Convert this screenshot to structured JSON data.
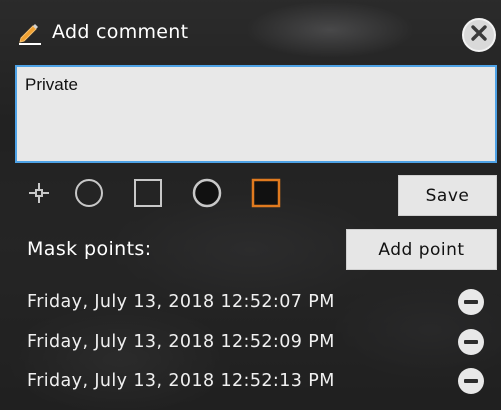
{
  "dialog": {
    "title": "Add comment",
    "title_icon": "pencil-icon",
    "close_icon": "close-icon"
  },
  "comment": {
    "value": "Private"
  },
  "tools": [
    {
      "icon": "crosshair-icon"
    },
    {
      "icon": "circle-outline-icon"
    },
    {
      "icon": "square-outline-icon"
    },
    {
      "icon": "circle-filled-icon"
    },
    {
      "icon": "square-filled-selected-icon",
      "selected": true,
      "accent": "#e07a1f"
    }
  ],
  "buttons": {
    "save_label": "Save",
    "add_point_label": "Add point"
  },
  "mask": {
    "label": "Mask points:",
    "points": [
      {
        "timestamp": "Friday, July 13, 2018 12:52:07 PM"
      },
      {
        "timestamp": "Friday, July 13, 2018 12:52:09 PM"
      },
      {
        "timestamp": "Friday, July 13, 2018 12:52:13 PM"
      }
    ]
  },
  "colors": {
    "accent_orange": "#e07a1f",
    "input_border": "#4ea2e6",
    "pencil_orange": "#f0a030"
  }
}
